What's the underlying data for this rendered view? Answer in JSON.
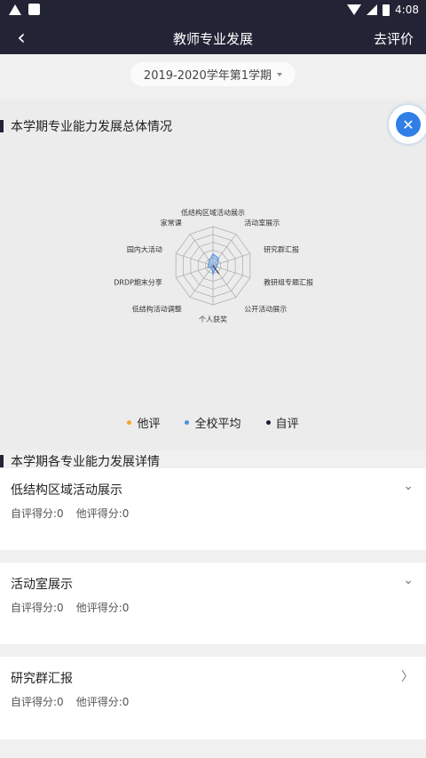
{
  "status_bar": {
    "time": "4:08"
  },
  "header": {
    "title": "教师专业发展",
    "action": "去评价"
  },
  "semester": {
    "label": "2019-2020学年第1学期"
  },
  "overview": {
    "title": "本学期专业能力发展总体情况",
    "fab_icon": "spark-icon",
    "chart_data": {
      "type": "radar",
      "axes": [
        "低结构区域活动展示",
        "活动室展示",
        "研究群汇报",
        "教研组专题汇报",
        "公开活动展示",
        "个人获奖",
        "低结构活动调整",
        "DRDP期末分享",
        "园内大活动",
        "家常课"
      ],
      "rmax": 5,
      "series": [
        {
          "name": "他评",
          "color": "#f5a623",
          "values": [
            0,
            0,
            0,
            0,
            0,
            0,
            0,
            0,
            0,
            0
          ]
        },
        {
          "name": "全校平均",
          "color": "#4a90e2",
          "values": [
            1.5,
            1.2,
            0.6,
            0.5,
            0.5,
            1.1,
            0.3,
            0.7,
            0.6,
            0.8
          ]
        },
        {
          "name": "自评",
          "color": "#1c1c3a",
          "values": [
            0,
            0,
            0,
            0,
            1.3,
            0,
            0,
            0,
            0,
            0
          ]
        }
      ]
    }
  },
  "legend": [
    {
      "label": "他评",
      "color": "#f5a623"
    },
    {
      "label": "全校平均",
      "color": "#4a90e2"
    },
    {
      "label": "自评",
      "color": "#1c1c3a"
    }
  ],
  "details": {
    "title": "本学期各专业能力发展详情",
    "items": [
      {
        "title": "低结构区域活动展示",
        "self": "自评得分:0",
        "peer": "他评得分:0",
        "icon": "chevron-down-icon",
        "glyph": "⌄"
      },
      {
        "title": "活动室展示",
        "self": "自评得分:0",
        "peer": "他评得分:0",
        "icon": "chevron-down-icon",
        "glyph": "⌄"
      },
      {
        "title": "研究群汇报",
        "self": "自评得分:0",
        "peer": "他评得分:0",
        "icon": "chevron-right-icon",
        "glyph": "〉"
      }
    ]
  }
}
